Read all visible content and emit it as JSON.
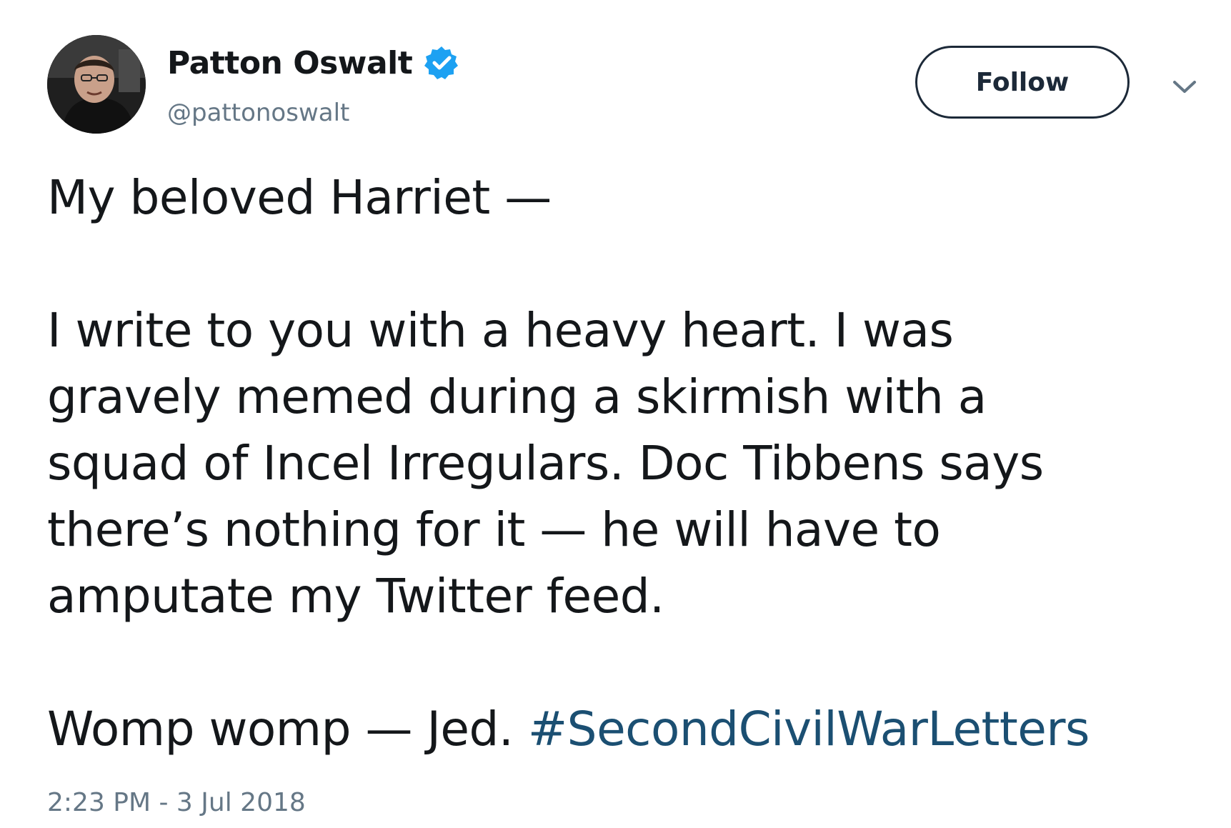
{
  "author": {
    "display_name": "Patton Oswalt",
    "handle": "@pattonoswalt",
    "verified": true,
    "avatar": "profile-photo"
  },
  "actions": {
    "follow_label": "Follow",
    "caret_icon": "chevron-down-icon"
  },
  "tweet": {
    "paragraph_1": "My beloved Harriet —",
    "paragraph_2": "I write to you with a heavy heart. I was\ngravely memed during a skirmish with a\nsquad of Incel Irregulars. Doc Tibbens says\nthere’s nothing for it — he will have to\namputate my Twitter feed.",
    "paragraph_3_text": "Womp womp — Jed. ",
    "hashtag": "#SecondCivilWarLetters"
  },
  "timestamp": "2:23 PM - 3 Jul 2018",
  "colors": {
    "text": "#14171a",
    "secondary": "#657786",
    "verified_blue": "#1da1f2",
    "hashtag": "#1b4f72",
    "button_border": "#1c2938"
  }
}
